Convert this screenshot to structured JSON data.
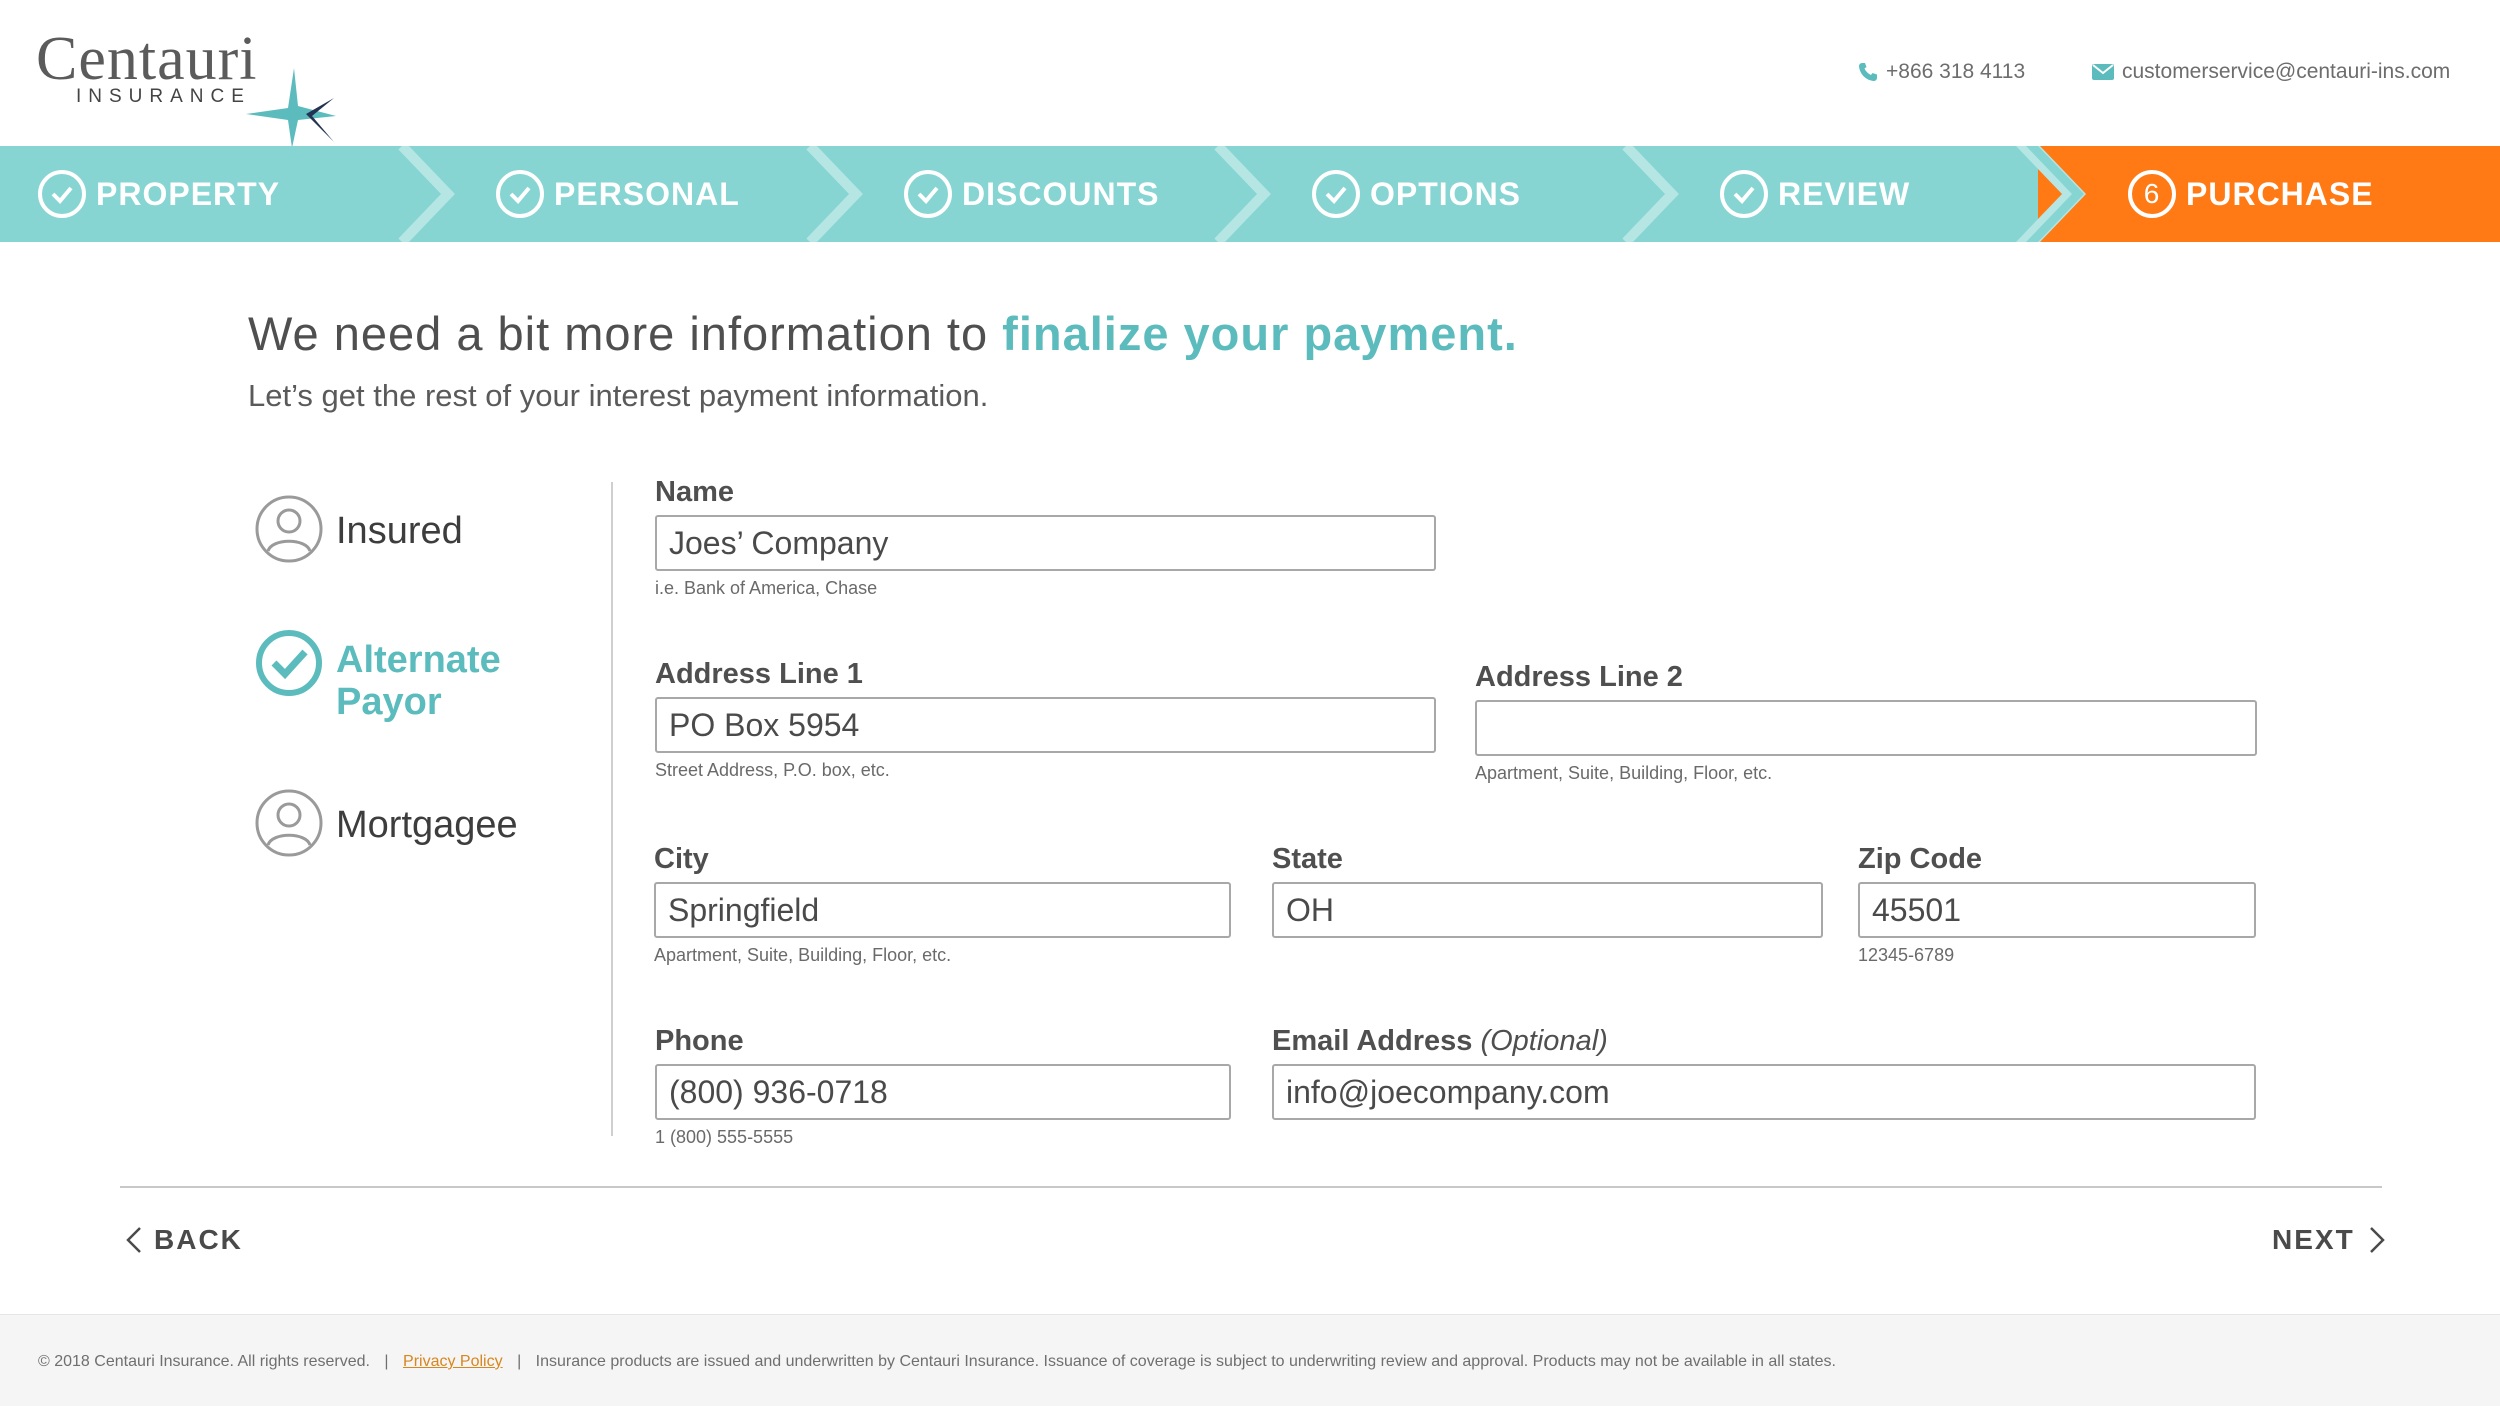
{
  "header": {
    "logo_text": "Centauri",
    "logo_subtext": "INSURANCE",
    "phone": "+866 318 4113",
    "email": "customerservice@centauri-ins.com"
  },
  "steps": [
    {
      "label": "PROPERTY",
      "state": "complete"
    },
    {
      "label": "PERSONAL",
      "state": "complete"
    },
    {
      "label": "DISCOUNTS",
      "state": "complete"
    },
    {
      "label": "OPTIONS",
      "state": "complete"
    },
    {
      "label": "REVIEW",
      "state": "complete"
    },
    {
      "label": "PURCHASE",
      "state": "current",
      "number": "6"
    }
  ],
  "colors": {
    "teal": "#86d5d3",
    "accent_teal": "#5cbcbd",
    "orange": "#ff7a14"
  },
  "main": {
    "headline_prefix": "We need a bit more information to ",
    "headline_highlight": "finalize your payment.",
    "subhead": "Let’s get the rest of your interest payment information."
  },
  "sidebar": {
    "items": [
      {
        "label": "Insured",
        "state": "inactive"
      },
      {
        "label_line1": "Alternate",
        "label_line2": "Payor",
        "state": "active"
      },
      {
        "label": "Mortgagee",
        "state": "inactive"
      }
    ]
  },
  "form": {
    "name": {
      "label": "Name",
      "value": "Joes’ Company",
      "help": "i.e. Bank of America, Chase"
    },
    "address1": {
      "label": "Address Line 1",
      "value": "PO Box 5954",
      "help": "Street Address, P.O. box, etc."
    },
    "address2": {
      "label": "Address Line 2",
      "value": "",
      "help": "Apartment, Suite, Building, Floor, etc."
    },
    "city": {
      "label": "City",
      "value": "Springfield",
      "help": "Apartment, Suite, Building, Floor, etc."
    },
    "state": {
      "label": "State",
      "value": "OH"
    },
    "zip": {
      "label": "Zip Code",
      "value": "45501",
      "help": "12345-6789"
    },
    "phone": {
      "label": "Phone",
      "value": "(800) 936-0718",
      "help": "1 (800) 555-5555"
    },
    "email": {
      "label": "Email Address",
      "optional": "(Optional)",
      "value": "info@joecompany.com"
    }
  },
  "nav": {
    "back": "BACK",
    "next": "NEXT"
  },
  "footer": {
    "copyright": "© 2018 Centauri Insurance. All rights reserved.",
    "separator": "|",
    "privacy": "Privacy Policy",
    "disclaimer": "Insurance products are issued and underwritten by Centauri Insurance.  Issuance of coverage is subject to underwriting review and approval. Products may not be available in all states."
  }
}
